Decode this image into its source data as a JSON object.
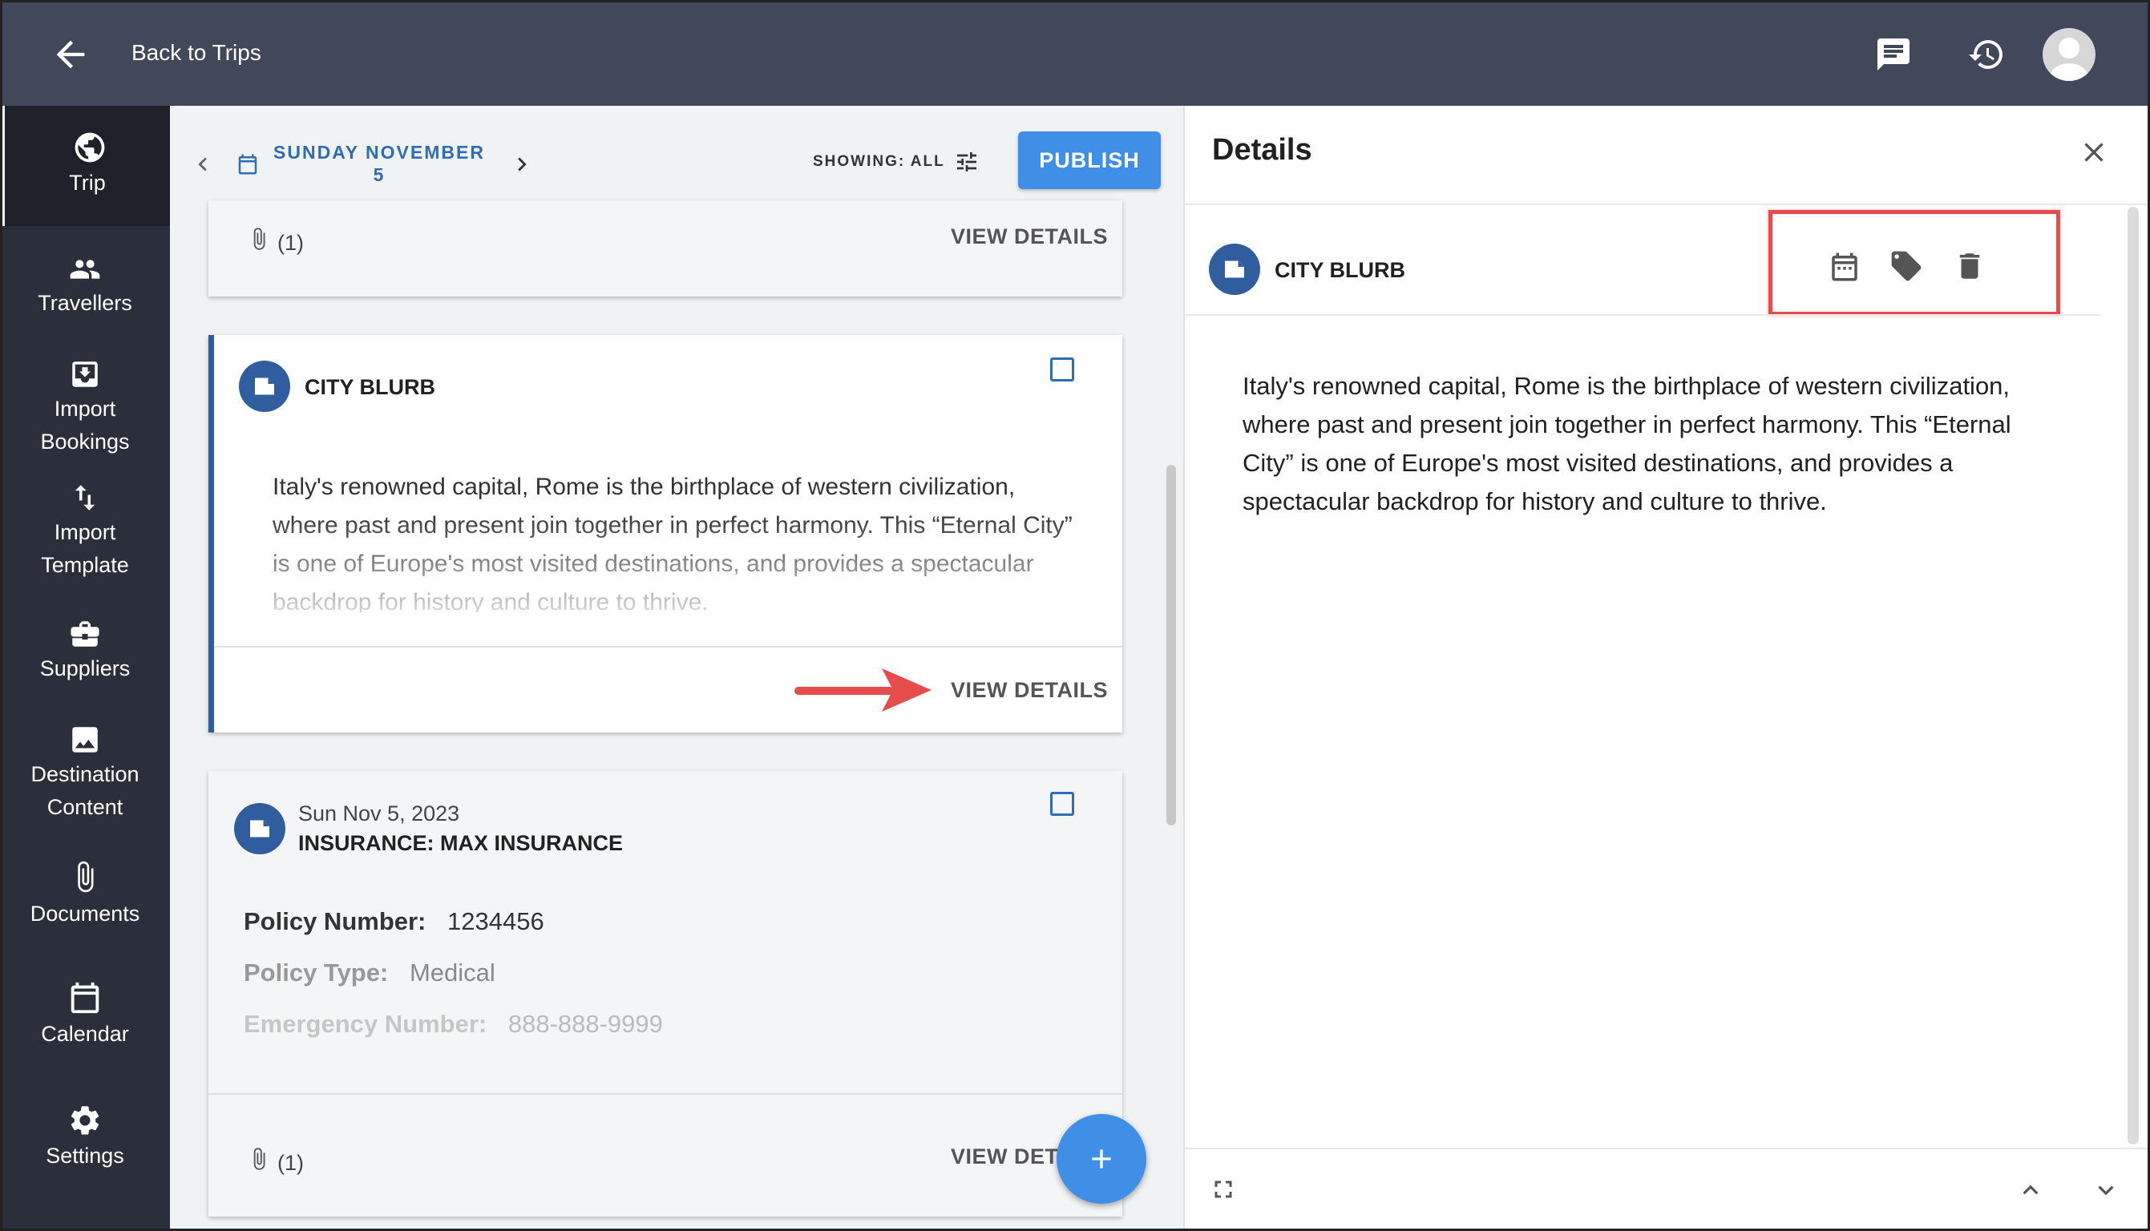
{
  "header": {
    "back_label": "Back to Trips",
    "icons": [
      "back-arrow-icon",
      "chat-icon",
      "history-icon",
      "avatar"
    ]
  },
  "sidebar": {
    "items": [
      {
        "label": "Trip",
        "icon": "globe-icon",
        "active": true
      },
      {
        "label": "Travellers",
        "icon": "people-icon"
      },
      {
        "label": "Import Bookings",
        "icon": "import-icon"
      },
      {
        "label": "Import Template",
        "icon": "sort-arrows-icon"
      },
      {
        "label": "Suppliers",
        "icon": "briefcase-icon"
      },
      {
        "label": "Destination Content",
        "icon": "image-icon"
      },
      {
        "label": "Documents",
        "icon": "paperclip-icon"
      },
      {
        "label": "Calendar",
        "icon": "calendar-icon"
      },
      {
        "label": "Settings",
        "icon": "gear-icon"
      }
    ]
  },
  "toolbar": {
    "date_label": "SUNDAY NOVEMBER 5",
    "showing_label": "SHOWING: ALL",
    "publish_label": "PUBLISH"
  },
  "cards": {
    "top": {
      "attachment_count": "(1)",
      "view_details": "VIEW DETAILS"
    },
    "blurb": {
      "title": "CITY BLURB",
      "body": "Italy's renowned capital, Rome is the birthplace of western civilization, where past and present join together in perfect harmony. This “Eternal City” is one of Europe's most visited destinations, and provides a spectacular backdrop for history and culture to thrive.",
      "view_details": "VIEW DETAILS"
    },
    "insurance": {
      "date": "Sun Nov 5, 2023",
      "title": "INSURANCE: MAX INSURANCE",
      "fields": [
        {
          "label": "Policy Number:",
          "value": "1234456"
        },
        {
          "label": "Policy Type:",
          "value": "Medical"
        },
        {
          "label": "Emergency Number:",
          "value": "888-888-9999"
        }
      ],
      "attachment_count": "(1)",
      "view_details": "VIEW DETAILS"
    }
  },
  "details": {
    "title": "Details",
    "item_title": "CITY BLURB",
    "body": "Italy's renowned capital, Rome is the birthplace of western civilization, where past and present join together in perfect harmony. This “Eternal City” is one of Europe's most visited destinations, and provides a spectacular backdrop for history and culture to thrive.",
    "action_icons": [
      "calendar-icon",
      "tag-icon",
      "trash-icon"
    ]
  },
  "colors": {
    "topbar": "#414859",
    "sidebar": "#2b2f3c",
    "accent": "#3f8fe6",
    "brand_blue": "#2f5d9e",
    "highlight": "#e74c4c"
  }
}
